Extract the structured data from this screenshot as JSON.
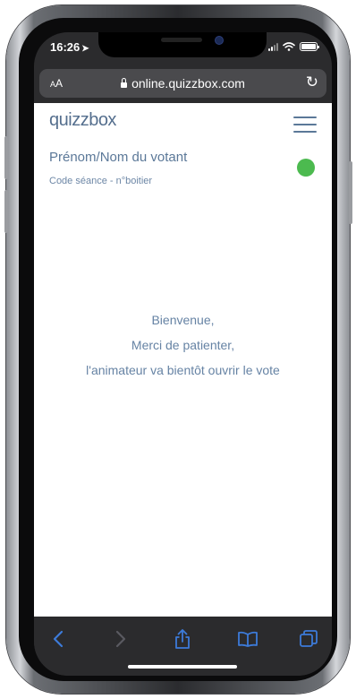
{
  "status_bar": {
    "time": "16:26",
    "location_arrow": "➤"
  },
  "browser": {
    "text_size_large": "A",
    "text_size_small": "A",
    "url": "online.quizzbox.com",
    "reload_icon": "↻"
  },
  "page": {
    "logo": "quizzbox",
    "voter_name": "Prénom/Nom du votant",
    "session_code": "Code séance - n°boitier",
    "connection_status_color": "#4cba4f",
    "message_lines": [
      "Bienvenue,",
      "Merci de patienter,",
      "l'animateur va bientôt ouvrir le vote"
    ]
  },
  "toolbar": {
    "accent_color": "#3d7bd9",
    "disabled_color": "#5a5a60",
    "buttons": [
      "back-icon",
      "forward-icon",
      "share-icon",
      "bookmarks-icon",
      "tabs-icon"
    ]
  }
}
